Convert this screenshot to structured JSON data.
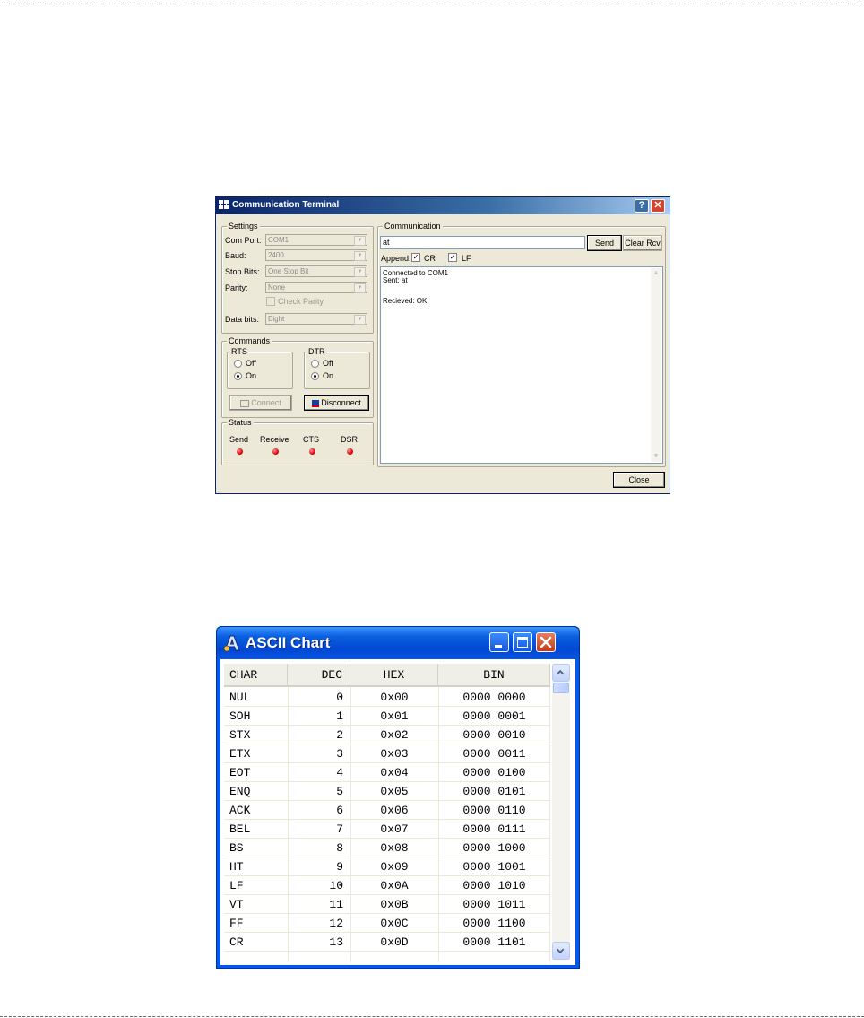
{
  "terminal": {
    "title": "Communication Terminal",
    "help_glyph": "?",
    "close_glyph": "✕",
    "settings": {
      "legend": "Settings",
      "com_port_label": "Com Port:",
      "com_port_value": "COM1",
      "baud_label": "Baud:",
      "baud_value": "2400",
      "stop_bits_label": "Stop Bits:",
      "stop_bits_value": "One Stop Bit",
      "parity_label": "Parity:",
      "parity_value": "None",
      "check_parity_label": "Check Parity",
      "data_bits_label": "Data bits:",
      "data_bits_value": "Eight"
    },
    "commands": {
      "legend": "Commands",
      "rts": {
        "legend": "RTS",
        "off": "Off",
        "on": "On",
        "selected": "On"
      },
      "dtr": {
        "legend": "DTR",
        "off": "Off",
        "on": "On",
        "selected": "On"
      },
      "connect_label": "Connect",
      "disconnect_label": "Disconnect"
    },
    "status": {
      "legend": "Status",
      "indicators": [
        "Send",
        "Receive",
        "CTS",
        "DSR"
      ],
      "led_color": "#e00000"
    },
    "communication": {
      "legend": "Communication",
      "input_value": "at",
      "send_label": "Send",
      "clear_label": "Clear Rcv",
      "append_label": "Append:",
      "cr_label": "CR",
      "cr_checked": true,
      "lf_label": "LF",
      "lf_checked": true,
      "log_lines": [
        "Connected to COM1",
        "Sent: at",
        "",
        "Recieved: OK"
      ]
    },
    "close_label": "Close"
  },
  "ascii": {
    "title": "ASCII Chart",
    "columns": [
      "CHAR",
      "DEC",
      "HEX",
      "BIN"
    ],
    "rows": [
      [
        "NUL",
        "0",
        "0x00",
        "0000 0000"
      ],
      [
        "SOH",
        "1",
        "0x01",
        "0000 0001"
      ],
      [
        "STX",
        "2",
        "0x02",
        "0000 0010"
      ],
      [
        "ETX",
        "3",
        "0x03",
        "0000 0011"
      ],
      [
        "EOT",
        "4",
        "0x04",
        "0000 0100"
      ],
      [
        "ENQ",
        "5",
        "0x05",
        "0000 0101"
      ],
      [
        "ACK",
        "6",
        "0x06",
        "0000 0110"
      ],
      [
        "BEL",
        "7",
        "0x07",
        "0000 0111"
      ],
      [
        "BS",
        "8",
        "0x08",
        "0000 1000"
      ],
      [
        "HT",
        "9",
        "0x09",
        "0000 1001"
      ],
      [
        "LF",
        "10",
        "0x0A",
        "0000 1010"
      ],
      [
        "VT",
        "11",
        "0x0B",
        "0000 1011"
      ],
      [
        "FF",
        "12",
        "0x0C",
        "0000 1100"
      ],
      [
        "CR",
        "13",
        "0x0D",
        "0000 1101"
      ]
    ]
  }
}
